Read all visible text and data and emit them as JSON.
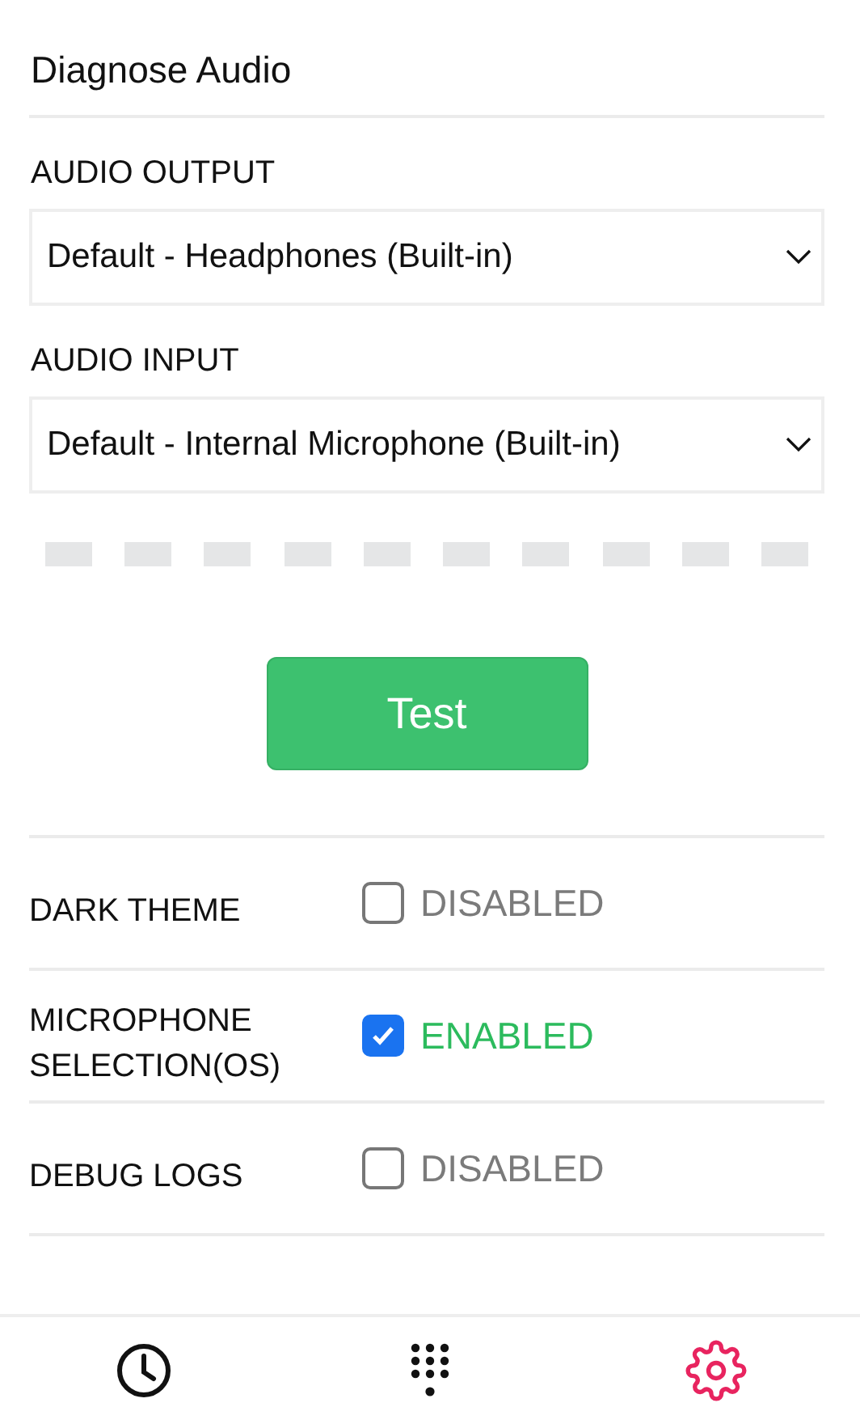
{
  "title": "Diagnose Audio",
  "audio_output": {
    "label": "AUDIO OUTPUT",
    "value": "Default - Headphones (Built-in)"
  },
  "audio_input": {
    "label": "AUDIO INPUT",
    "value": "Default - Internal Microphone (Built-in)"
  },
  "test_button": "Test",
  "settings": [
    {
      "label": "DARK THEME",
      "checked": false,
      "status": "DISABLED"
    },
    {
      "label": "MICROPHONE SELECTION(OS)",
      "checked": true,
      "status": "ENABLED"
    },
    {
      "label": "DEBUG LOGS",
      "checked": false,
      "status": "DISABLED"
    }
  ],
  "nav": [
    {
      "kind": "history",
      "selected": false
    },
    {
      "kind": "dialpad",
      "selected": false
    },
    {
      "kind": "settings",
      "selected": true
    }
  ]
}
